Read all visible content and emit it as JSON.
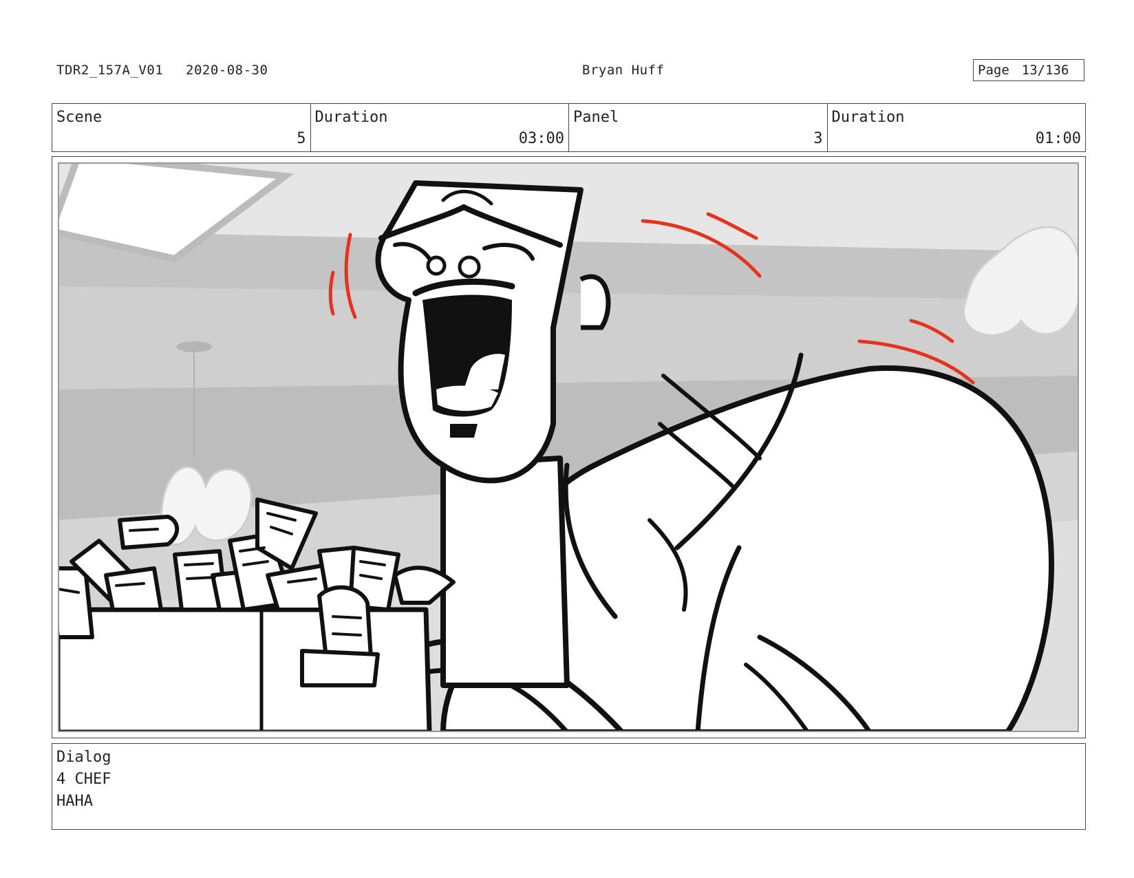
{
  "header": {
    "project": "TDR2_157A_V01",
    "date": "2020-08-30",
    "author": "Bryan Huff",
    "page_label": "Page",
    "page_number": "13/136"
  },
  "info": {
    "scene_label": "Scene",
    "scene_value": "5",
    "scene_duration_label": "Duration",
    "scene_duration_value": "03:00",
    "panel_label": "Panel",
    "panel_value": "3",
    "panel_duration_label": "Duration",
    "panel_duration_value": "01:00"
  },
  "dialog": {
    "label": "Dialog",
    "character": "4 CHEF",
    "line": "HAHA"
  },
  "colors": {
    "accent_motion_lines": "#e8321e"
  }
}
